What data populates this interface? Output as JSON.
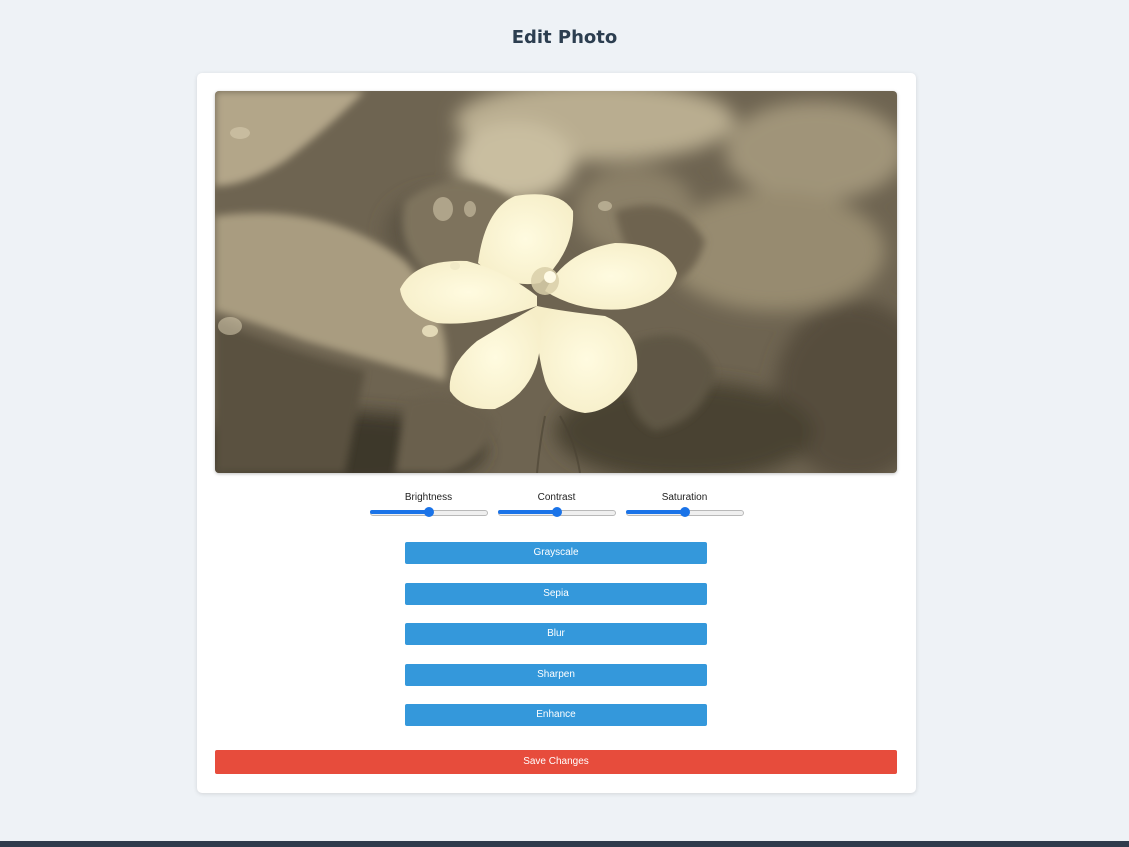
{
  "page": {
    "title": "Edit Photo"
  },
  "photo": {
    "filter": "sepia",
    "subject": "flower"
  },
  "sliders": [
    {
      "label": "Brightness",
      "value": 0.5
    },
    {
      "label": "Contrast",
      "value": 0.5
    },
    {
      "label": "Saturation",
      "value": 0.5
    }
  ],
  "filters": [
    {
      "label": "Grayscale"
    },
    {
      "label": "Sepia"
    },
    {
      "label": "Blur"
    },
    {
      "label": "Sharpen"
    },
    {
      "label": "Enhance"
    }
  ],
  "actions": {
    "save_label": "Save Changes"
  },
  "colors": {
    "background": "#eef2f6",
    "card": "#ffffff",
    "filter_button": "#3498db",
    "save_button": "#e74c3c",
    "slider_accent": "#1a73e8",
    "title": "#2c3e50",
    "footer": "#2f3b4c"
  }
}
